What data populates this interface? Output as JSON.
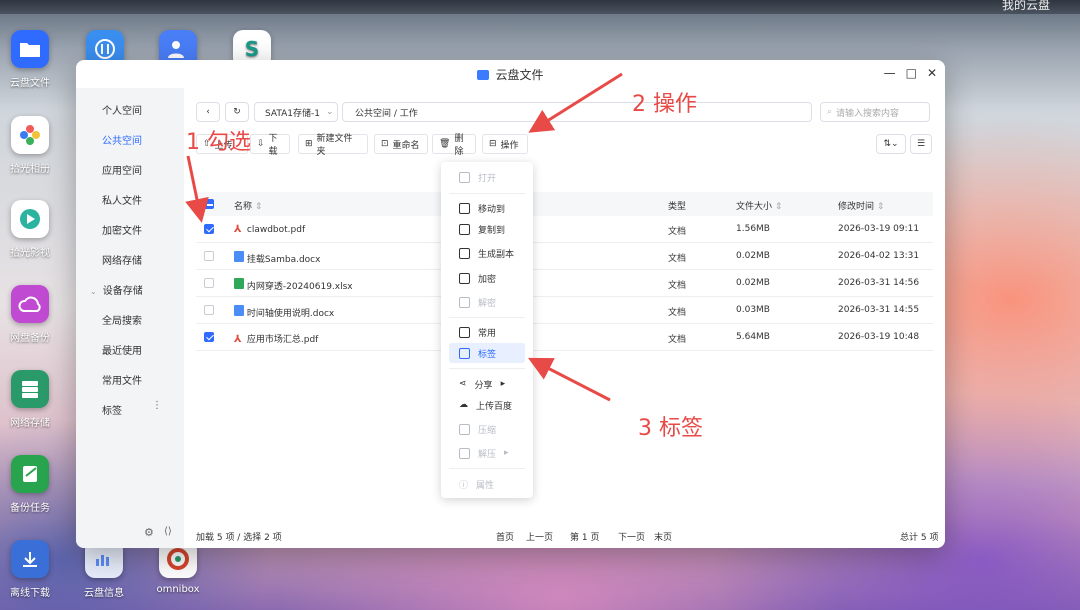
{
  "desktop": {
    "topbar_text": "我的云盘",
    "icons": [
      {
        "label": "云盘文件",
        "color": "#2f6bff"
      },
      {
        "label": "",
        "color": "#3a8ef0"
      },
      {
        "label": "",
        "color": "#4a7ef7"
      },
      {
        "label": "",
        "color": "#1a9a8a"
      },
      {
        "label": "拾光相册",
        "color": "#f2a33a"
      },
      {
        "label": "拾光影视",
        "color": "#2bb3a0"
      },
      {
        "label": "网盘备份",
        "color": "#c04ad1"
      },
      {
        "label": "网络存储",
        "color": "#2a9a6a"
      },
      {
        "label": "备份任务",
        "color": "#28a34e"
      },
      {
        "label": "离线下载",
        "color": "#3b6fd8"
      },
      {
        "label": "云盘信息",
        "color": "#5e8ef7"
      },
      {
        "label": "omnibox",
        "color": "#d8452f"
      }
    ]
  },
  "window": {
    "title": "云盘文件",
    "controls": [
      "—",
      "□",
      "✕"
    ]
  },
  "sidebar": {
    "items": [
      {
        "label": "个人空间"
      },
      {
        "label": "公共空间"
      },
      {
        "label": "应用空间"
      },
      {
        "label": "私人文件"
      },
      {
        "label": "加密文件"
      },
      {
        "label": "网络存储"
      },
      {
        "label": "设备存储"
      },
      {
        "label": "全局搜索"
      },
      {
        "label": "最近使用"
      },
      {
        "label": "常用文件"
      },
      {
        "label": "标签"
      }
    ]
  },
  "toolbar": {
    "storage_select": "SATA1存储-1",
    "path": "公共空间 / 工作",
    "search_placeholder": "请输入搜索内容",
    "upload_label": "上传",
    "download_label": "下载",
    "new_folder_label": "新建文件夹",
    "rename_label": "重命名",
    "delete_label": "删除",
    "operate_label": "操作"
  },
  "table": {
    "columns": [
      "名称",
      "类型",
      "文件大小",
      "修改时间"
    ],
    "rows": [
      {
        "name": "clawdbot.pdf",
        "type": "文档",
        "size": "1.56MB",
        "modified": "2026-03-19 09:11",
        "checked": true
      },
      {
        "name": "挂载Samba.docx",
        "type": "文档",
        "size": "0.02MB",
        "modified": "2026-04-02 13:31",
        "checked": false
      },
      {
        "name": "内网穿透-20240619.xlsx",
        "type": "文档",
        "size": "0.02MB",
        "modified": "2026-03-31 14:56",
        "checked": false
      },
      {
        "name": "时间轴使用说明.docx",
        "type": "文档",
        "size": "0.03MB",
        "modified": "2026-03-31 14:55",
        "checked": false
      },
      {
        "name": "应用市场汇总.pdf",
        "type": "文档",
        "size": "5.64MB",
        "modified": "2026-03-19 10:48",
        "checked": true
      }
    ]
  },
  "context_menu": {
    "items": [
      {
        "label": "打开",
        "disabled": true
      },
      {
        "label": "移动到",
        "disabled": false
      },
      {
        "label": "复制到",
        "disabled": false
      },
      {
        "label": "生成副本",
        "disabled": false
      },
      {
        "label": "加密",
        "disabled": false
      },
      {
        "label": "解密",
        "disabled": true
      },
      {
        "label": "常用",
        "disabled": false
      },
      {
        "label": "标签",
        "disabled": false
      },
      {
        "label": "分享",
        "disabled": false
      },
      {
        "label": "上传百度",
        "disabled": false
      },
      {
        "label": "压缩",
        "disabled": true
      },
      {
        "label": "解压",
        "disabled": true
      },
      {
        "label": "属性",
        "disabled": true
      }
    ]
  },
  "footer": {
    "status": "加载 5 项 / 选择 2 项",
    "first": "首页",
    "prev": "上一页",
    "page": "第 1 页",
    "next": "下一页",
    "last": "末页",
    "total": "总计 5 项"
  },
  "annotations": {
    "step1": "1 勾选",
    "step2": "2 操作",
    "step3": "3 标签"
  }
}
